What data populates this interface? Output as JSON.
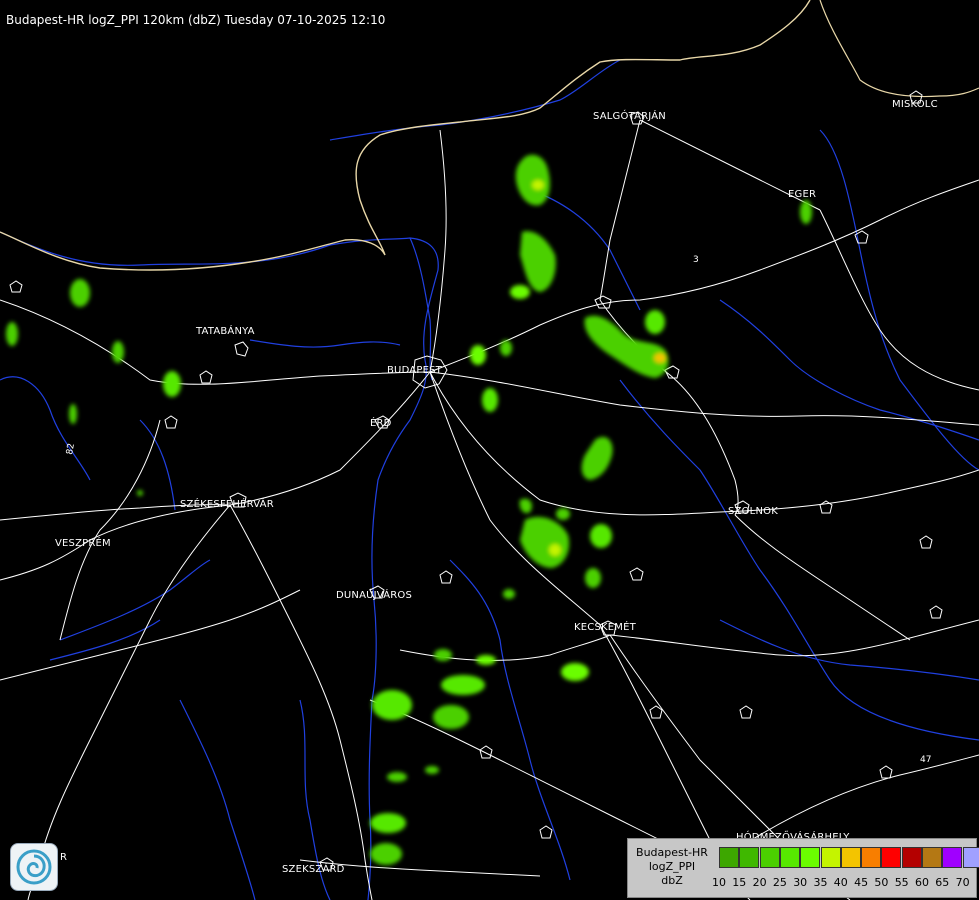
{
  "title": "Budapest-HR logZ_PPI 120km (dbZ) Tuesday 07-10-2025 12:10",
  "cities": [
    {
      "id": "salgotarjan",
      "name": "SALGÓTARJÁN"
    },
    {
      "id": "eger",
      "name": "EGER"
    },
    {
      "id": "tatabanya",
      "name": "TATABÁNYA"
    },
    {
      "id": "budapest",
      "name": "BUDAPEST"
    },
    {
      "id": "erd",
      "name": "ÉRD"
    },
    {
      "id": "szekesfehervar",
      "name": "SZÉKESFEHÉRVÁR"
    },
    {
      "id": "veszprem",
      "name": "VESZPRÉM"
    },
    {
      "id": "dunaujvaros",
      "name": "DUNAÚJVÁROS"
    },
    {
      "id": "szolnok",
      "name": "SZOLNOK"
    },
    {
      "id": "kecskemet",
      "name": "KECSKEMÉT"
    },
    {
      "id": "hodmezovasarhely",
      "name": "HÓDMEZŐVÁSÁRHELY"
    },
    {
      "id": "szekszard",
      "name": "SZEKSZÁRD"
    },
    {
      "id": "miskolc",
      "name": "MISKOLC"
    },
    {
      "id": "partial_sw",
      "name": "R"
    }
  ],
  "legend": {
    "line1": "Budapest-HR",
    "line2": "logZ_PPI",
    "line3": "dbZ",
    "levels": [
      {
        "value": "10",
        "color": "#3da700"
      },
      {
        "value": "15",
        "color": "#3fb800"
      },
      {
        "value": "20",
        "color": "#4bd000"
      },
      {
        "value": "25",
        "color": "#57e800"
      },
      {
        "value": "30",
        "color": "#6bfd00"
      },
      {
        "value": "35",
        "color": "#c4f400"
      },
      {
        "value": "40",
        "color": "#f3c400"
      },
      {
        "value": "45",
        "color": "#f87e00"
      },
      {
        "value": "50",
        "color": "#ff0000"
      },
      {
        "value": "55",
        "color": "#b40000"
      },
      {
        "value": "60",
        "color": "#b47814"
      },
      {
        "value": "65",
        "color": "#a000ff"
      },
      {
        "value": "70",
        "color": "#a0a0ff"
      }
    ]
  },
  "road_numbers": [
    "82",
    "3",
    "47"
  ],
  "colors": {
    "background": "#000000",
    "rivers": "#1f3ee0",
    "roads": "#ffffff",
    "border": "#e8d7a8"
  }
}
